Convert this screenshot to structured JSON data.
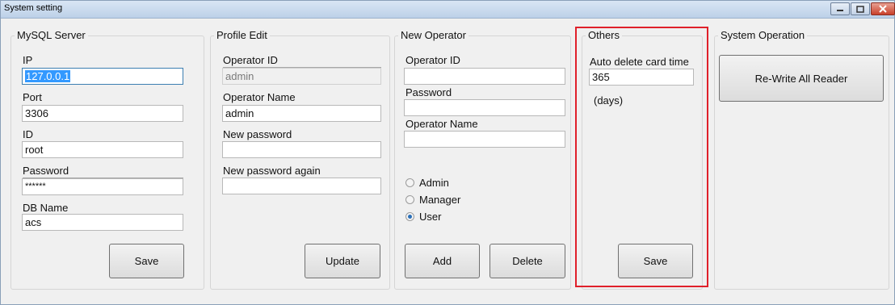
{
  "window": {
    "title": "System setting"
  },
  "mysql": {
    "title": "MySQL Server",
    "ip_label": "IP",
    "ip_value": "127.0.0.1",
    "port_label": "Port",
    "port_value": "3306",
    "id_label": "ID",
    "id_value": "root",
    "password_label": "Password",
    "password_value": "******",
    "dbname_label": "DB Name",
    "dbname_value": "acs",
    "save_label": "Save"
  },
  "profile": {
    "title": "Profile Edit",
    "operator_id_label": "Operator ID",
    "operator_id_value": "admin",
    "operator_name_label": "Operator Name",
    "operator_name_value": "admin",
    "new_password_label": "New password",
    "new_password_value": "",
    "new_password_again_label": "New password again",
    "new_password_again_value": "",
    "update_label": "Update"
  },
  "new_operator": {
    "title": "New Operator",
    "operator_id_label": "Operator ID",
    "operator_id_value": "",
    "password_label": "Password",
    "password_value": "",
    "operator_name_label": "Operator Name",
    "operator_name_value": "",
    "roles": [
      {
        "label": "Admin",
        "selected": false
      },
      {
        "label": "Manager",
        "selected": false
      },
      {
        "label": "User",
        "selected": true
      }
    ],
    "add_label": "Add",
    "delete_label": "Delete"
  },
  "others": {
    "title": "Others",
    "auto_delete_label": "Auto delete card time",
    "auto_delete_value": "365",
    "unit": "(days)",
    "save_label": "Save"
  },
  "system_operation": {
    "title": "System Operation",
    "rewrite_label": "Re-Write All Reader"
  },
  "colors": {
    "highlight": "#e0202a",
    "selection": "#3399ff",
    "titlebar": "#c9d9ec"
  }
}
